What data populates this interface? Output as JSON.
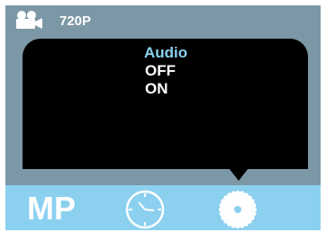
{
  "status_bar": {
    "camera_icon": "video-camera-icon",
    "resolution": "720P"
  },
  "menu": {
    "title": "Audio",
    "options": [
      "OFF",
      "ON"
    ]
  },
  "bottom_bar": {
    "mode_label": "MP",
    "clock_icon": "clock-icon",
    "settings_icon": "gear-icon"
  },
  "colors": {
    "background": "#7c97a6",
    "accent": "#8cd0f0",
    "panel": "#000000",
    "text": "#ffffff"
  }
}
